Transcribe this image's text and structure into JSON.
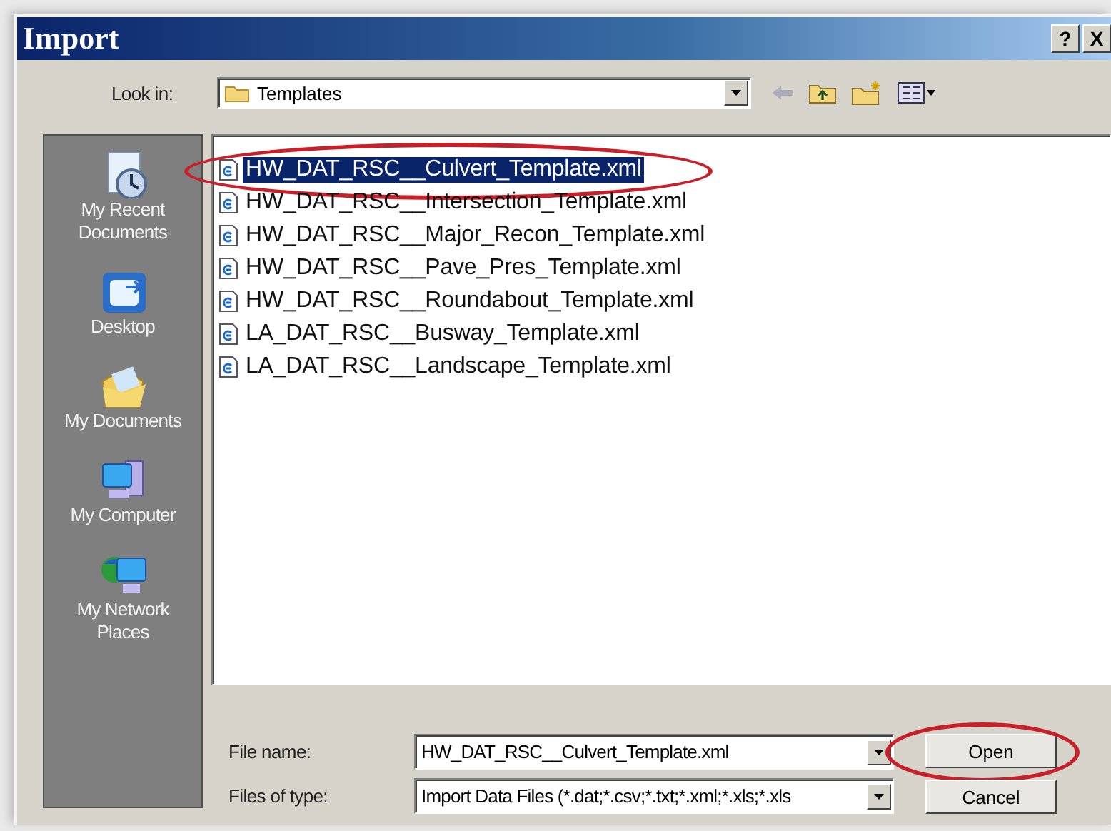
{
  "window": {
    "title": "Import",
    "buttons": [
      "?",
      "X"
    ]
  },
  "look_in": {
    "label": "Look in:",
    "value": "Templates"
  },
  "places": [
    {
      "kind": "recent",
      "label": "My Recent Documents"
    },
    {
      "kind": "desktop",
      "label": "Desktop"
    },
    {
      "kind": "documents",
      "label": "My Documents"
    },
    {
      "kind": "computer",
      "label": "My Computer"
    },
    {
      "kind": "network",
      "label": "My Network Places"
    }
  ],
  "files": [
    {
      "name": "HW_DAT_RSC__Culvert_Template.xml",
      "selected": true,
      "circled": true
    },
    {
      "name": "HW_DAT_RSC__Intersection_Template.xml",
      "selected": false,
      "circled": false
    },
    {
      "name": "HW_DAT_RSC__Major_Recon_Template.xml",
      "selected": false,
      "circled": false
    },
    {
      "name": "HW_DAT_RSC__Pave_Pres_Template.xml",
      "selected": false,
      "circled": false
    },
    {
      "name": "HW_DAT_RSC__Roundabout_Template.xml",
      "selected": false,
      "circled": false
    },
    {
      "name": "LA_DAT_RSC__Busway_Template.xml",
      "selected": false,
      "circled": false
    },
    {
      "name": "LA_DAT_RSC__Landscape_Template.xml",
      "selected": false,
      "circled": false
    }
  ],
  "file_name": {
    "label": "File name:",
    "value": "HW_DAT_RSC__Culvert_Template.xml"
  },
  "files_of_type": {
    "label": "Files of type:",
    "value": "Import Data Files (*.dat;*.csv;*.txt;*.xml;*.xls;*.xls"
  },
  "buttons": [
    {
      "label": "Open",
      "circled": true
    },
    {
      "label": "Cancel",
      "circled": false
    }
  ]
}
